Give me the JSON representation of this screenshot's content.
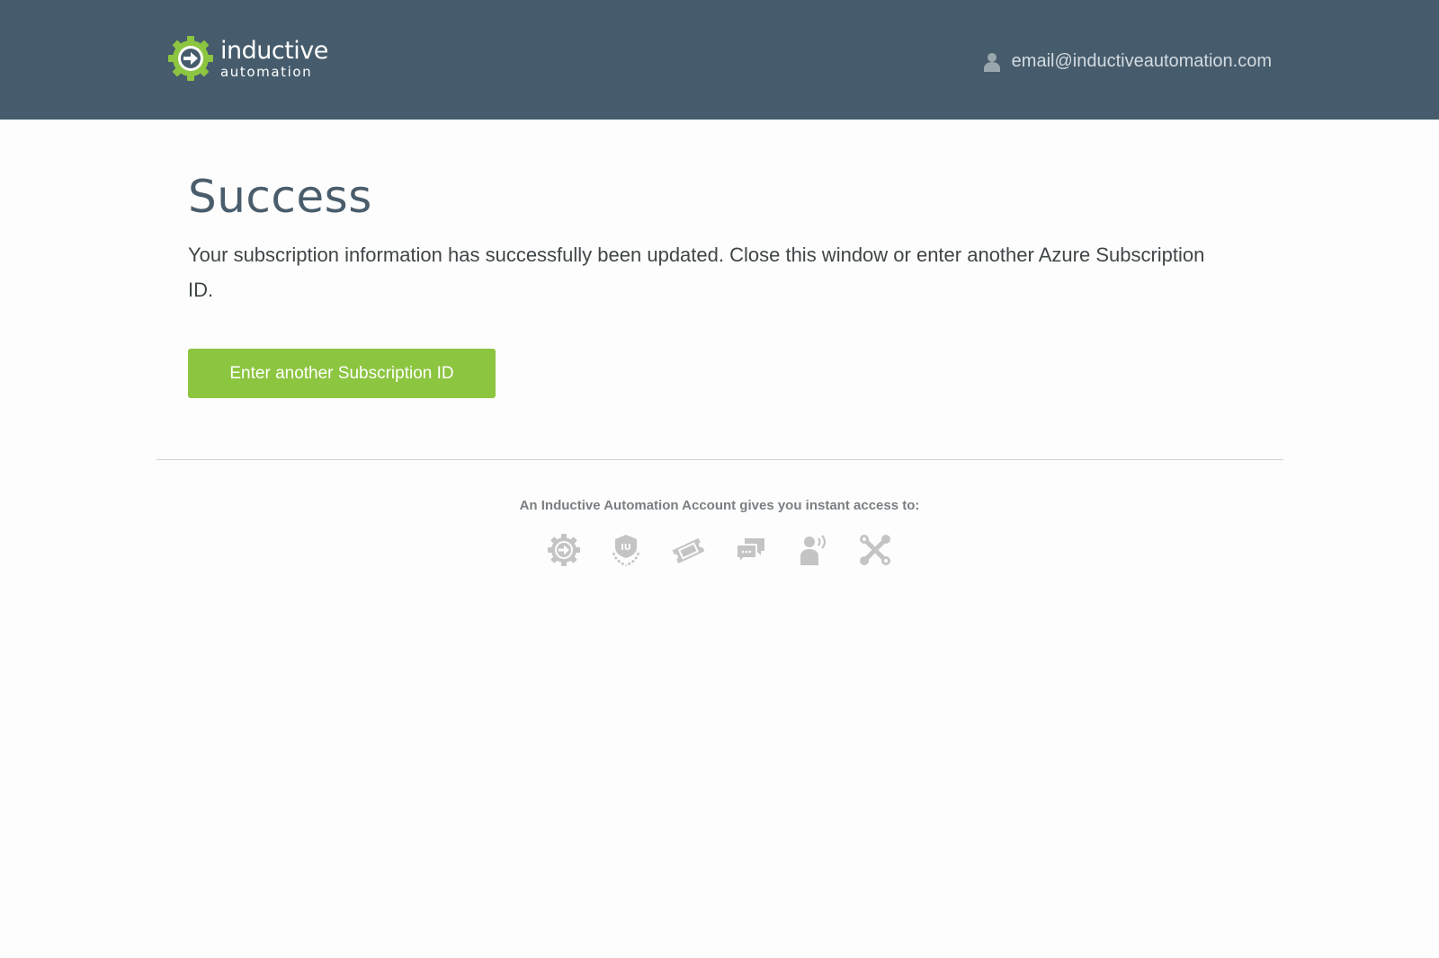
{
  "header": {
    "logo": {
      "line1": "inductive",
      "line2": "automation",
      "icon": "gear-arrow-icon"
    },
    "user": {
      "icon": "user-icon",
      "email": "email@inductiveautomation.com"
    }
  },
  "main": {
    "title": "Success",
    "message": "Your subscription information has successfully been updated. Close this window or enter another Azure Subscription ID.",
    "button_label": "Enter another Subscription ID"
  },
  "footer": {
    "access_text": "An Inductive Automation Account gives you instant access to:",
    "icons": [
      "gear-arrow-icon",
      "iu-badge-icon",
      "ticket-icon",
      "chat-bubbles-icon",
      "speaking-person-icon",
      "tools-icon"
    ]
  },
  "colors": {
    "header_bg": "#465c6c",
    "accent_green": "#8cc540",
    "title_color": "#4a5d6c",
    "icon_gray": "#c4c4c4"
  }
}
